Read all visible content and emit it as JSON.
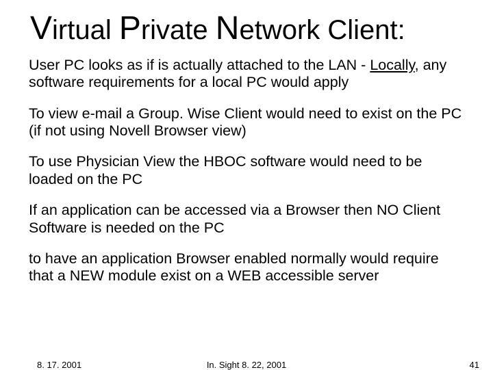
{
  "title": {
    "v": "V",
    "irtual": "irtual ",
    "p": "P",
    "rivate": "rivate ",
    "n": "N",
    "etwork": "etwork Client:"
  },
  "paragraphs": {
    "p1a": "User PC looks as if is actually attached to the LAN - ",
    "p1b": "Locally",
    "p1c": ", any software requirements for a local PC would apply",
    "p2": "To view e-mail a Group. Wise Client would need to exist on the PC (if not using Novell Browser view)",
    "p3": "To use Physician View the HBOC software would need to be loaded on the PC",
    "p4": "If an application can be accessed via a Browser then NO Client Software is needed on the PC",
    "p5": "to have an application Browser enabled normally would require that a NEW module exist on a WEB accessible server"
  },
  "footer": {
    "left": "8. 17. 2001",
    "center": "In. Sight 8. 22, 2001",
    "right": "41"
  }
}
